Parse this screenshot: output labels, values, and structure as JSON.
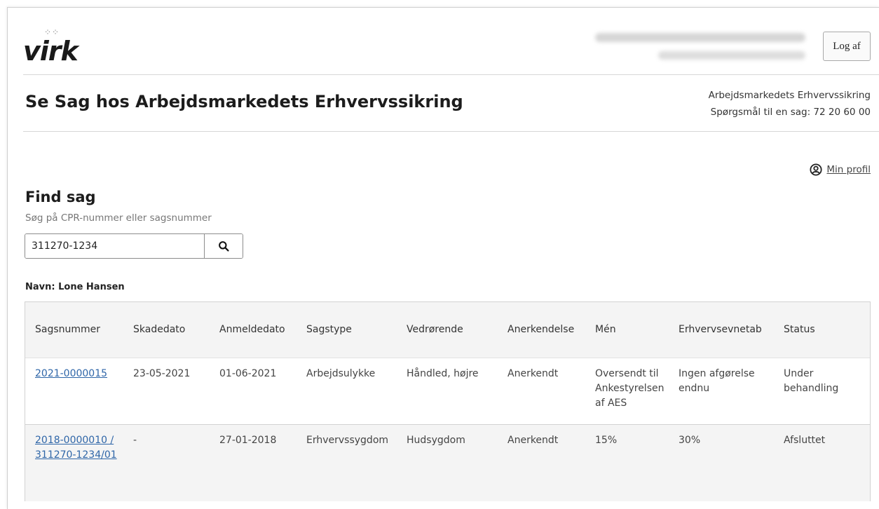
{
  "header": {
    "logo_text": "virk",
    "logout_label": "Log af"
  },
  "page": {
    "title": "Se Sag hos Arbejdsmarkedets Erhvervssikring",
    "org_name": "Arbejdsmarkedets Erhvervssikring",
    "org_phone": "Spørgsmål til en sag: 72 20 60 00",
    "profile_label": "Min profil"
  },
  "search": {
    "heading": "Find sag",
    "hint": "Søg på CPR-nummer eller sagsnummer",
    "value": "311270-1234"
  },
  "person": {
    "name_label": "Navn: Lone Hansen"
  },
  "table": {
    "headers": [
      "Sagsnummer",
      "Skadedato",
      "Anmeldedato",
      "Sagstype",
      "Vedrørende",
      "Anerkendelse",
      "Mén",
      "Erhvervsevnetab",
      "Status"
    ],
    "rows": [
      [
        "2021-0000015",
        "23-05-2021",
        "01-06-2021",
        "Arbejdsulykke",
        "Håndled, højre",
        "Anerkendt",
        "Oversendt til Ankestyrelsen af AES",
        "Ingen afgørelse endnu",
        "Under behandling"
      ],
      [
        "2018-0000010 / 311270-1234/01",
        "-",
        "27-01-2018",
        "Erhvervssygdom",
        "Hudsygdom",
        "Anerkendt",
        "15%",
        "30%",
        "Afsluttet"
      ]
    ]
  },
  "icons": {
    "crown": "crown-icon",
    "profile": "user-circle-icon",
    "search": "search-icon"
  },
  "colors": {
    "link": "#2f66a8",
    "header_row": "#f4f4f4"
  }
}
